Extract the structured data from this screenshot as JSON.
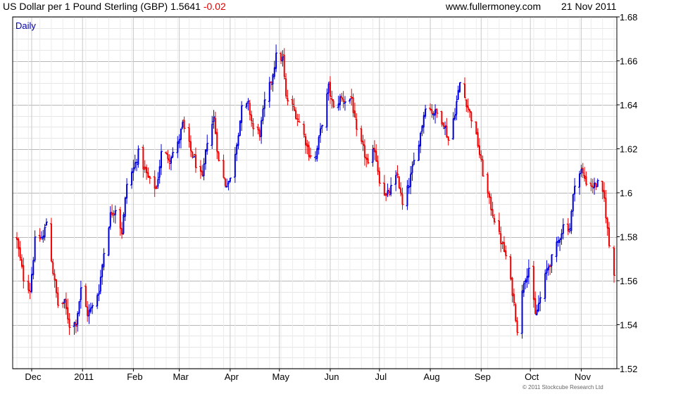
{
  "header": {
    "title": "US Dollar per 1 Pound Sterling (GBP)",
    "last": "1.5641",
    "change": "-0.02",
    "site": "www.fullermoney.com",
    "date": "21 Nov 2011"
  },
  "footer": {
    "copyright": "© 2011 Stockcube Research Ltd"
  },
  "colors": {
    "up": "#0000dd",
    "down": "#ee0000",
    "grid": "#d8d8d8",
    "frame": "#000000",
    "label": "#0000aa"
  },
  "chart_data": {
    "type": "candlestick-bar",
    "period_label": "Daily",
    "xlabel": "",
    "ylabel": "",
    "ylim": [
      1.52,
      1.68
    ],
    "y_ticks": [
      "1.52",
      "1.54",
      "1.56",
      "1.58",
      "1.6",
      "1.62",
      "1.64",
      "1.66",
      "1.68"
    ],
    "x_ticks": [
      "Dec",
      "2011",
      "Feb",
      "Mar",
      "Apr",
      "May",
      "Jun",
      "Jul",
      "Aug",
      "Sep",
      "Oct",
      "Nov"
    ],
    "x_tick_dates": [
      "2010-12-01",
      "2011-01-01",
      "2011-02-01",
      "2011-03-01",
      "2011-04-01",
      "2011-05-01",
      "2011-06-01",
      "2011-07-01",
      "2011-08-01",
      "2011-09-01",
      "2011-10-01",
      "2011-11-01"
    ],
    "date_range": [
      "2010-11-22",
      "2011-11-21"
    ],
    "grid": true,
    "series": [
      {
        "close_points": [
          [
            "2010-11-22",
            1.578
          ],
          [
            "2010-11-26",
            1.561
          ],
          [
            "2010-11-30",
            1.556
          ],
          [
            "2010-12-03",
            1.578
          ],
          [
            "2010-12-08",
            1.58
          ],
          [
            "2010-12-10",
            1.587
          ],
          [
            "2010-12-14",
            1.564
          ],
          [
            "2010-12-17",
            1.549
          ],
          [
            "2010-12-21",
            1.55
          ],
          [
            "2010-12-24",
            1.54
          ],
          [
            "2010-12-28",
            1.541
          ],
          [
            "2010-12-31",
            1.556
          ],
          [
            "2011-01-04",
            1.545
          ],
          [
            "2011-01-07",
            1.548
          ],
          [
            "2011-01-11",
            1.556
          ],
          [
            "2011-01-14",
            1.573
          ],
          [
            "2011-01-18",
            1.59
          ],
          [
            "2011-01-21",
            1.593
          ],
          [
            "2011-01-25",
            1.582
          ],
          [
            "2011-01-28",
            1.604
          ],
          [
            "2011-02-01",
            1.611
          ],
          [
            "2011-02-04",
            1.618
          ],
          [
            "2011-02-08",
            1.61
          ],
          [
            "2011-02-11",
            1.605
          ],
          [
            "2011-02-15",
            1.602
          ],
          [
            "2011-02-18",
            1.618
          ],
          [
            "2011-02-23",
            1.616
          ],
          [
            "2011-02-28",
            1.622
          ],
          [
            "2011-03-03",
            1.631
          ],
          [
            "2011-03-08",
            1.619
          ],
          [
            "2011-03-11",
            1.613
          ],
          [
            "2011-03-15",
            1.606
          ],
          [
            "2011-03-18",
            1.624
          ],
          [
            "2011-03-22",
            1.634
          ],
          [
            "2011-03-25",
            1.614
          ],
          [
            "2011-03-29",
            1.604
          ],
          [
            "2011-04-01",
            1.606
          ],
          [
            "2011-04-05",
            1.623
          ],
          [
            "2011-04-08",
            1.638
          ],
          [
            "2011-04-12",
            1.64
          ],
          [
            "2011-04-15",
            1.629
          ],
          [
            "2011-04-19",
            1.627
          ],
          [
            "2011-04-22",
            1.641
          ],
          [
            "2011-04-26",
            1.651
          ],
          [
            "2011-04-29",
            1.662
          ],
          [
            "2011-05-03",
            1.661
          ],
          [
            "2011-05-05",
            1.643
          ],
          [
            "2011-05-09",
            1.639
          ],
          [
            "2011-05-12",
            1.634
          ],
          [
            "2011-05-16",
            1.626
          ],
          [
            "2011-05-19",
            1.618
          ],
          [
            "2011-05-23",
            1.616
          ],
          [
            "2011-05-26",
            1.628
          ],
          [
            "2011-05-31",
            1.648
          ],
          [
            "2011-06-03",
            1.638
          ],
          [
            "2011-06-07",
            1.643
          ],
          [
            "2011-06-10",
            1.642
          ],
          [
            "2011-06-14",
            1.643
          ],
          [
            "2011-06-17",
            1.627
          ],
          [
            "2011-06-21",
            1.62
          ],
          [
            "2011-06-24",
            1.612
          ],
          [
            "2011-06-28",
            1.62
          ],
          [
            "2011-07-01",
            1.606
          ],
          [
            "2011-07-05",
            1.598
          ],
          [
            "2011-07-08",
            1.602
          ],
          [
            "2011-07-12",
            1.608
          ],
          [
            "2011-07-15",
            1.594
          ],
          [
            "2011-07-19",
            1.604
          ],
          [
            "2011-07-22",
            1.614
          ],
          [
            "2011-07-26",
            1.627
          ],
          [
            "2011-07-29",
            1.64
          ],
          [
            "2011-08-02",
            1.637
          ],
          [
            "2011-08-05",
            1.636
          ],
          [
            "2011-08-09",
            1.632
          ],
          [
            "2011-08-12",
            1.624
          ],
          [
            "2011-08-16",
            1.637
          ],
          [
            "2011-08-19",
            1.65
          ],
          [
            "2011-08-23",
            1.641
          ],
          [
            "2011-08-26",
            1.634
          ],
          [
            "2011-08-30",
            1.622
          ],
          [
            "2011-09-02",
            1.609
          ],
          [
            "2011-09-06",
            1.596
          ],
          [
            "2011-09-09",
            1.588
          ],
          [
            "2011-09-13",
            1.578
          ],
          [
            "2011-09-16",
            1.571
          ],
          [
            "2011-09-20",
            1.555
          ],
          [
            "2011-09-23",
            1.538
          ],
          [
            "2011-09-27",
            1.56
          ],
          [
            "2011-09-30",
            1.566
          ],
          [
            "2011-10-04",
            1.544
          ],
          [
            "2011-10-07",
            1.552
          ],
          [
            "2011-10-11",
            1.565
          ],
          [
            "2011-10-14",
            1.57
          ],
          [
            "2011-10-18",
            1.578
          ],
          [
            "2011-10-21",
            1.585
          ],
          [
            "2011-10-25",
            1.584
          ],
          [
            "2011-10-28",
            1.605
          ],
          [
            "2011-11-01",
            1.61
          ],
          [
            "2011-11-04",
            1.605
          ],
          [
            "2011-11-08",
            1.603
          ],
          [
            "2011-11-11",
            1.604
          ],
          [
            "2011-11-15",
            1.597
          ],
          [
            "2011-11-18",
            1.576
          ],
          [
            "2011-11-21",
            1.564
          ]
        ]
      }
    ]
  }
}
